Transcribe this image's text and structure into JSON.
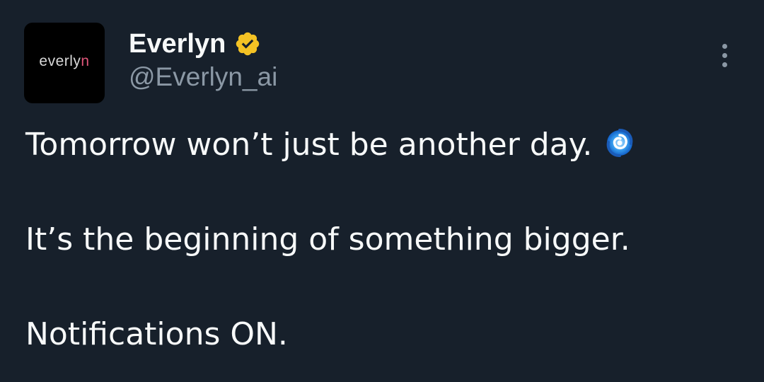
{
  "author": {
    "avatar_text_main": "everly",
    "avatar_text_accent": "n",
    "display_name": "Everlyn",
    "handle": "@Everlyn_ai",
    "verified_icon": "gold-verified-badge",
    "verified_color": "#f4c224"
  },
  "menu": {
    "icon": "more-vertical-icon"
  },
  "tweet": {
    "line1": "Tomorrow won’t just be another day.",
    "line1_emoji": "cyclone-icon",
    "line2": "It’s the beginning of something bigger.",
    "line3": "Notifications ON."
  },
  "colors": {
    "background": "#17202b",
    "text": "#f7f9f9",
    "muted": "#8b98a5"
  }
}
